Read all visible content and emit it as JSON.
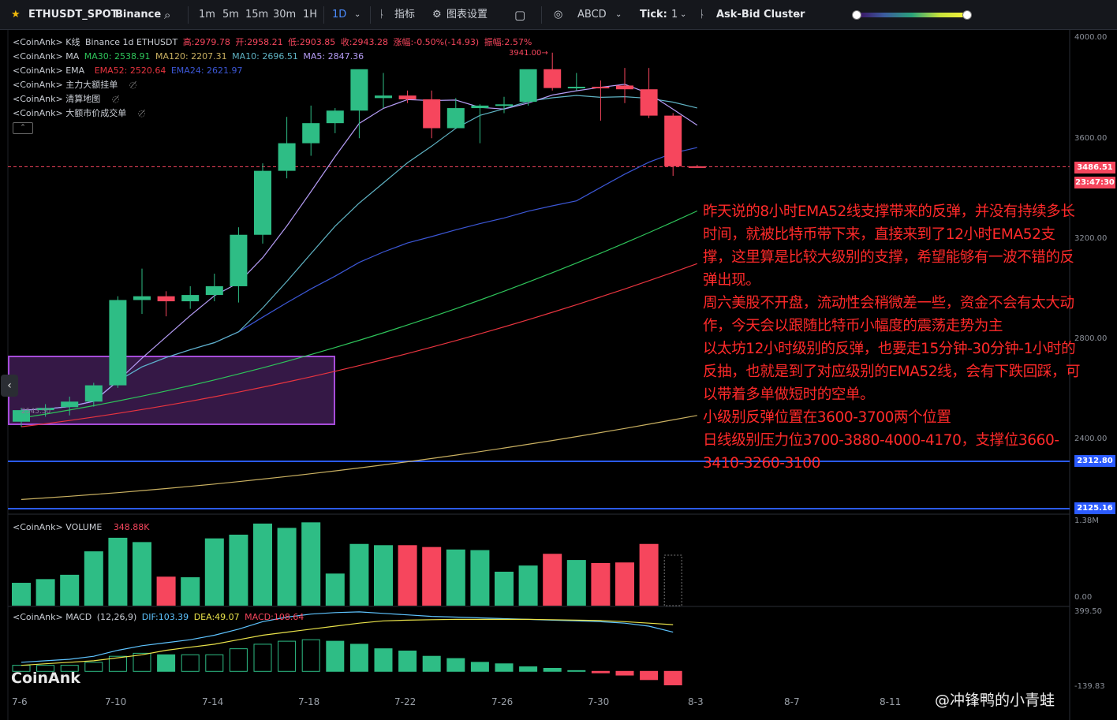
{
  "toolbar": {
    "symbol": "ETHUSDT_SPOT",
    "exchange": "Binance",
    "intervals": [
      "1m",
      "5m",
      "15m",
      "30m",
      "1H",
      "1D"
    ],
    "active_interval": "1D",
    "indicators_label": "指标",
    "settings_label": "图表设置",
    "drawing_label": "ABCD",
    "tick_label": "Tick:",
    "tick_value": "1",
    "cluster_label": "Ask-Bid Cluster"
  },
  "legend": {
    "kline": {
      "prefix": "<CoinAnk> K线",
      "source": "Binance 1d ETHUSDT",
      "high": "高:2979.78",
      "open": "开:2958.21",
      "low": "低:2903.85",
      "close": "收:2943.28",
      "change": "涨幅:-0.50%(-14.93)",
      "amp": "振幅:2.57%"
    },
    "ma": {
      "prefix": "<CoinAnk> MA",
      "ma30": "MA30: 2538.91",
      "ma120": "MA120: 2207.31",
      "ma10": "MA10: 2696.51",
      "ma5": "MA5: 2847.36"
    },
    "ema": {
      "prefix": "<CoinAnk> EMA",
      "ema52": "EMA52: 2520.64",
      "ema24": "EMA24: 2621.97"
    },
    "orders": "<CoinAnk> 主力大额挂单",
    "liq": "<CoinAnk> 清算地图",
    "trades": "<CoinAnk> 大额市价成交单",
    "volume_prefix": "<CoinAnk> VOLUME",
    "volume_value": "348.88K",
    "macd_prefix": "<CoinAnk> MACD",
    "macd_params": "(12,26,9)",
    "dif": "DIF:103.39",
    "dea": "DEA:49.07",
    "macd": "MACD:108.64"
  },
  "price_axis": {
    "ticks": [
      "4000.00",
      "3600.00",
      "3200.00",
      "2800.00",
      "2400.00"
    ]
  },
  "price_tags": {
    "last": "3486.51",
    "countdown": "23:47:30",
    "line1": "2312.80",
    "line2": "2125.16"
  },
  "volume_axis": {
    "top": "1.38M",
    "bottom": "0.00"
  },
  "macd_axis": {
    "top": "399.50",
    "bottom": "-139.83"
  },
  "high_marker": "3941.00",
  "left_box_label": "2545.50",
  "x_ticks": [
    "7-6",
    "7-10",
    "7-14",
    "7-18",
    "7-22",
    "7-26",
    "7-30",
    "8-3",
    "8-7",
    "8-11"
  ],
  "annotation": [
    "昨天说的8小时EMA52线支撑带来的反弹，并没有持续多长时间，就被比特币带下来，直接来到了12小时EMA52支撑，这里算是比较大级别的支撑，希望能够有一波不错的反弹出现。",
    "周六美股不开盘，流动性会稍微差一些，资金不会有太大动作，今天会以跟随比特币小幅度的震荡走势为主",
    "以太坊12小时级别的反弹，也要走15分钟-30分钟-1小时的反抽，也就是到了对应级别的EMA52线，会有下跌回踩，可以带着多单做短时的空单。",
    "小级别反弹位置在3600-3700两个位置",
    "日线级别压力位3700-3880-4000-4170，支撑位3660-3410-3260-3100"
  ],
  "logo": "CoinAnk",
  "watermark": "@冲锋鸭的小青蛙",
  "colors": {
    "up": "#2ebd85",
    "down": "#f6465d",
    "ma5": "#b59cf5",
    "ma10": "#5fb3c4",
    "ma30": "#2ec45a",
    "ma120": "#c9b061",
    "ema52": "#e8343f",
    "ema24": "#3c57d6",
    "box": "#a64cd9",
    "hline": "#2b5bff"
  },
  "chart_data": {
    "type": "candlestick",
    "dates": [
      "7-5",
      "7-6",
      "7-7",
      "7-8",
      "7-9",
      "7-10",
      "7-11",
      "7-12",
      "7-13",
      "7-14",
      "7-15",
      "7-16",
      "7-17",
      "7-18",
      "7-19",
      "7-20",
      "7-21",
      "7-22",
      "7-23",
      "7-24",
      "7-25",
      "7-26",
      "7-27",
      "7-28",
      "7-29",
      "7-30",
      "7-31",
      "8-1",
      "8-2"
    ],
    "ohlc": [
      [
        2470,
        2525,
        2450,
        2516
      ],
      [
        2516,
        2540,
        2490,
        2525
      ],
      [
        2528,
        2570,
        2495,
        2550
      ],
      [
        2550,
        2625,
        2530,
        2615
      ],
      [
        2615,
        2970,
        2605,
        2955
      ],
      [
        2955,
        3080,
        2900,
        2970
      ],
      [
        2970,
        2990,
        2890,
        2950
      ],
      [
        2950,
        3010,
        2920,
        2975
      ],
      [
        2975,
        3060,
        2950,
        3010
      ],
      [
        3010,
        3245,
        2945,
        3215
      ],
      [
        3215,
        3500,
        3180,
        3470
      ],
      [
        3470,
        3685,
        3440,
        3580
      ],
      [
        3580,
        3730,
        3530,
        3660
      ],
      [
        3660,
        3720,
        3620,
        3710
      ],
      [
        3710,
        3825,
        3600,
        3875
      ],
      [
        3760,
        3860,
        3720,
        3770
      ],
      [
        3770,
        3790,
        3740,
        3755
      ],
      [
        3755,
        3790,
        3600,
        3640
      ],
      [
        3640,
        3760,
        3640,
        3720
      ],
      [
        3720,
        3735,
        3580,
        3730
      ],
      [
        3730,
        3765,
        3700,
        3735
      ],
      [
        3745,
        3820,
        3730,
        3875
      ],
      [
        3875,
        3941,
        3790,
        3800
      ],
      [
        3800,
        3860,
        3790,
        3805
      ],
      [
        3805,
        3830,
        3670,
        3800
      ],
      [
        3810,
        3880,
        3740,
        3795
      ],
      [
        3795,
        3880,
        3680,
        3690
      ],
      [
        3690,
        3700,
        3450,
        3488
      ],
      [
        3488,
        3494,
        3486,
        3486
      ]
    ],
    "volume": [
      370,
      430,
      500,
      880,
      1100,
      1030,
      470,
      460,
      1090,
      1150,
      1330,
      1260,
      1350,
      520,
      1000,
      980,
      980,
      950,
      910,
      900,
      550,
      650,
      840,
      740,
      690,
      700,
      1000,
      0
    ],
    "volume_max": 1380000,
    "macd": {
      "dif": [
        60,
        70,
        80,
        100,
        140,
        170,
        190,
        210,
        240,
        280,
        330,
        360,
        380,
        390,
        395,
        385,
        375,
        365,
        360,
        355,
        350,
        345,
        340,
        335,
        330,
        320,
        300,
        260
      ],
      "dea": [
        40,
        50,
        60,
        70,
        90,
        110,
        140,
        160,
        180,
        210,
        240,
        260,
        280,
        300,
        320,
        335,
        340,
        343,
        345,
        345,
        345,
        345,
        343,
        340,
        337,
        330,
        320,
        310
      ],
      "hist": [
        40,
        40,
        40,
        60,
        100,
        120,
        110,
        110,
        110,
        150,
        180,
        200,
        210,
        200,
        180,
        150,
        135,
        100,
        85,
        60,
        50,
        30,
        20,
        5,
        -10,
        -25,
        -55,
        -90
      ],
      "range": [
        -139.83,
        399.5
      ]
    },
    "ylim": [
      2065,
      4010
    ]
  }
}
